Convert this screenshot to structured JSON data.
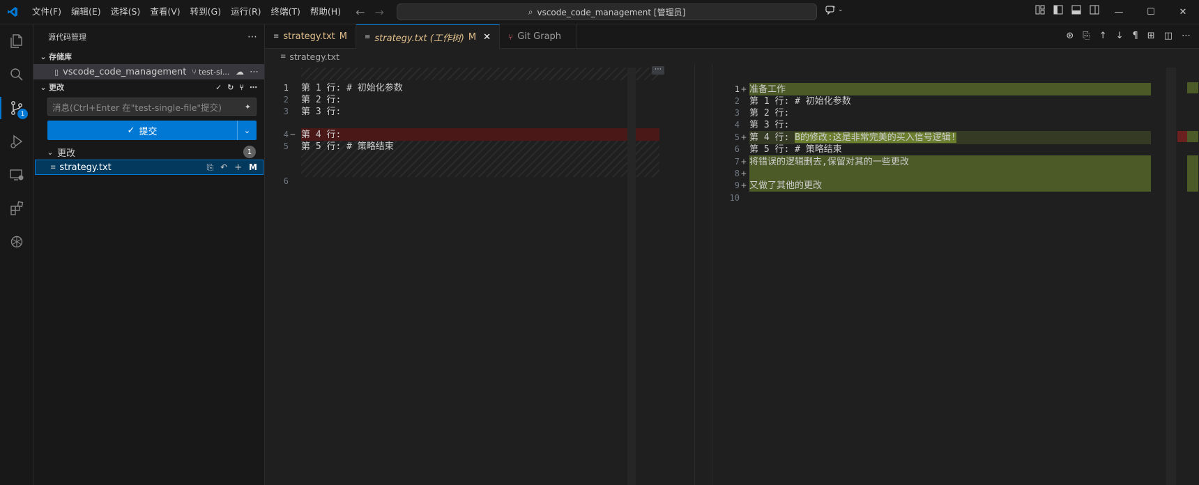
{
  "titlebar": {
    "menus": [
      "文件(F)",
      "编辑(E)",
      "选择(S)",
      "查看(V)",
      "转到(G)",
      "运行(R)",
      "终端(T)",
      "帮助(H)"
    ],
    "search": "vscode_code_management [管理员]"
  },
  "activity": {
    "scm_badge": "1"
  },
  "sidebar": {
    "title": "源代码管理",
    "repos_section": "存储库",
    "repo_name": "vscode_code_management",
    "branch": "test-si...",
    "changes_section": "更改",
    "message_placeholder": "消息(Ctrl+Enter 在\"test-single-file\"提交)",
    "commit_label": "提交",
    "changes_group": "更改",
    "changes_count": "1",
    "file_name": "strategy.txt",
    "file_status": "M"
  },
  "tabs": [
    {
      "label": "strategy.txt",
      "status": "M"
    },
    {
      "label": "strategy.txt (工作树)",
      "status": "M"
    },
    {
      "label": "Git Graph"
    }
  ],
  "breadcrumb": "strategy.txt",
  "diff": {
    "left": [
      {
        "n": "1",
        "text": "第 1 行: # 初始化参数"
      },
      {
        "n": "2",
        "text": "第 2 行:"
      },
      {
        "n": "3",
        "text": "第 3 行:"
      },
      {
        "n": "4",
        "text": "第 4 行:",
        "mark": "−"
      },
      {
        "n": "5",
        "text": "第 5 行: # 策略结束"
      },
      {
        "n": "6",
        "text": ""
      }
    ],
    "right": [
      {
        "n": "1",
        "text": "准备工作",
        "mark": "+"
      },
      {
        "n": "2",
        "text": "第 1 行: # 初始化参数"
      },
      {
        "n": "3",
        "text": "第 2 行:"
      },
      {
        "n": "4",
        "text": "第 3 行:"
      },
      {
        "n": "5",
        "text": "第 4 行: ",
        "inserted": "B的修改:这是非常完美的买入信号逻辑!",
        "mark": "+"
      },
      {
        "n": "6",
        "text": "第 5 行: # 策略结束"
      },
      {
        "n": "7",
        "text": "将错误的逻辑删去,保留对其的一些更改",
        "mark": "+"
      },
      {
        "n": "8",
        "text": "",
        "mark": "+"
      },
      {
        "n": "9",
        "text": "又做了其他的更改",
        "mark": "+"
      },
      {
        "n": "10",
        "text": ""
      }
    ]
  }
}
